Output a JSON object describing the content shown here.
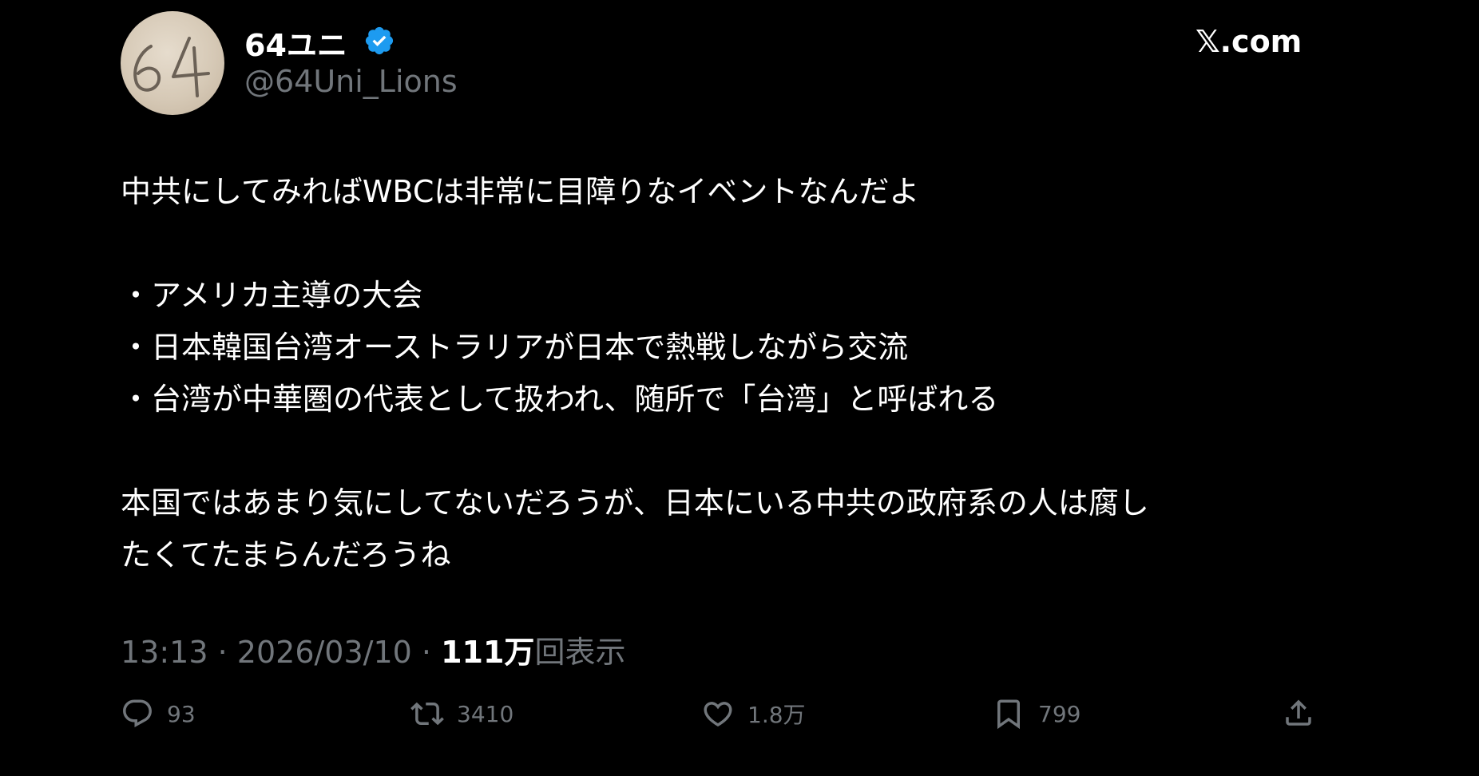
{
  "header": {
    "display_name": "64ユニ",
    "handle": "@64Uni_Lions",
    "avatar_text": "64",
    "brand": "𝕏.com"
  },
  "post": {
    "lines": [
      "中共にしてみればWBCは非常に目障りなイベントなんだよ",
      "・アメリカ主導の大会",
      "・日本韓国台湾オーストラリアが日本で熱戦しながら交流",
      "・台湾が中華圏の代表として扱われ、随所で「台湾」と呼ばれる",
      "本国ではあまり気にしてないだろうが、日本にいる中共の政府系の人は腐し",
      "たくてたまらんだろうね"
    ]
  },
  "meta": {
    "time": "13:13",
    "separator": "·",
    "date": "2026/03/10",
    "views_count": "111万",
    "views_label": "回表示"
  },
  "actions": {
    "replies": "93",
    "reposts": "3410",
    "likes": "1.8万",
    "bookmarks": "799"
  },
  "colors": {
    "background": "#000000",
    "text_primary": "#ffffff",
    "text_secondary": "#71767b",
    "verified_badge": "#1d9bf0"
  }
}
